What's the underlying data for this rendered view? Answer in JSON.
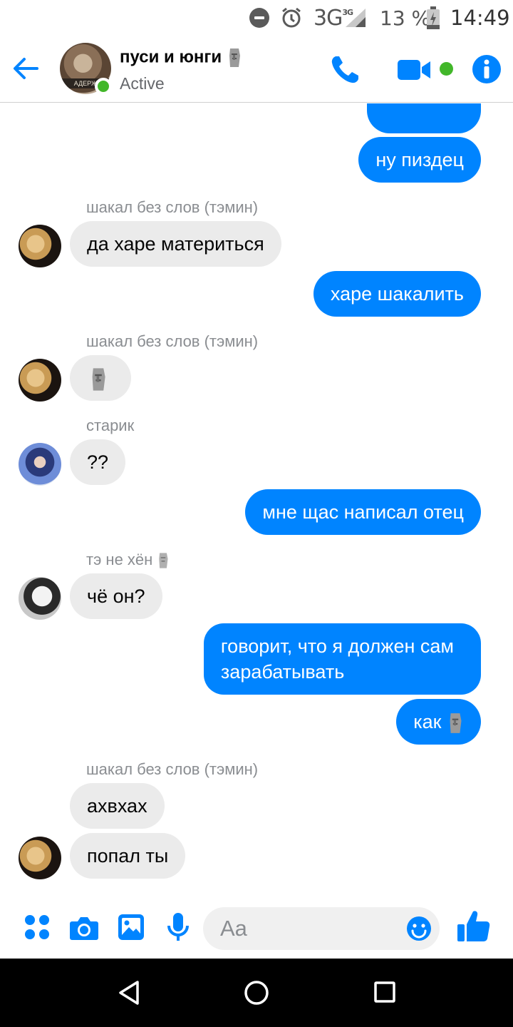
{
  "status_bar": {
    "network": "3G",
    "network_small": "3G",
    "battery_percent": "13 %",
    "time": "14:49",
    "icons": [
      "do-not-disturb-icon",
      "alarm-icon",
      "signal-icon",
      "battery-icon"
    ]
  },
  "header": {
    "title": "пуси и юнги",
    "status": "Active",
    "avatar_caption": "АДЕРЖ",
    "accent_color": "#0084ff",
    "online_color": "#42b72a",
    "icons": [
      "back-arrow-icon",
      "phone-icon",
      "video-camera-icon",
      "info-icon"
    ]
  },
  "messages": [
    {
      "side": "out",
      "text": ""
    },
    {
      "side": "out",
      "text": "ну пиздец"
    },
    {
      "side": "in",
      "sender": "шакал без слов (тэмин)",
      "text": "да харе материться"
    },
    {
      "side": "out",
      "text": "харе шакалить"
    },
    {
      "side": "in",
      "sender": "шакал без слов (тэмин)",
      "text": "",
      "emoji": "moai"
    },
    {
      "side": "in",
      "sender": "старик",
      "text": "??"
    },
    {
      "side": "out",
      "text": "мне щас написал отец"
    },
    {
      "side": "in",
      "sender": "тэ не хён",
      "text": "чё он?"
    },
    {
      "side": "out",
      "text_lines": [
        "говорит, что я должен сам",
        "зарабатывать"
      ]
    },
    {
      "side": "out",
      "text": "как",
      "emoji": "moai"
    },
    {
      "side": "in",
      "sender": "шакал без слов (тэмин)",
      "text": "ахвхах"
    },
    {
      "side": "in",
      "text": "попал ты"
    }
  ],
  "composer": {
    "placeholder": "Aa",
    "icons": [
      "more-grid-icon",
      "camera-icon",
      "gallery-icon",
      "microphone-icon",
      "emoji-icon",
      "like-icon"
    ]
  },
  "navbar": {
    "icons": [
      "nav-back-icon",
      "nav-home-icon",
      "nav-recents-icon"
    ]
  }
}
